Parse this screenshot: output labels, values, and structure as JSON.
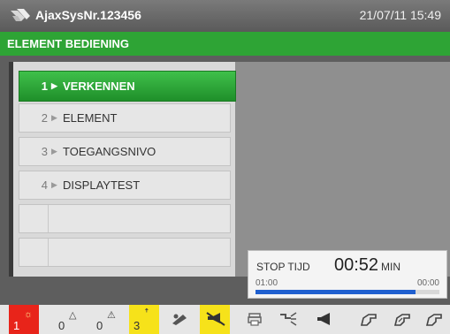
{
  "header": {
    "system_name": "AjaxSysNr.123456",
    "datetime": "21/07/11 15:49",
    "logo_icon": "ajax-logo-icon"
  },
  "title": "ELEMENT BEDIENING",
  "menu": {
    "items": [
      {
        "num": "1",
        "label": "VERKENNEN",
        "active": true
      },
      {
        "num": "2",
        "label": "ELEMENT"
      },
      {
        "num": "3",
        "label": "TOEGANGSNIVO"
      },
      {
        "num": "4",
        "label": "DISPLAYTEST"
      }
    ],
    "arrow": "▶"
  },
  "timer": {
    "label": "STOP TIJD",
    "time": "00:52",
    "unit": "MIN",
    "start": "01:00",
    "end": "00:00",
    "progress_fraction": 0.87
  },
  "status": {
    "items": [
      {
        "count": "1",
        "symbol": "☼",
        "color": "#e8241a",
        "icon": "fire-alarm-icon"
      },
      {
        "count": "0",
        "symbol": "△",
        "icon": "fault-icon"
      },
      {
        "count": "0",
        "symbol": "⚠",
        "icon": "warning-icon"
      },
      {
        "count": "3",
        "symbol": "ꜛ",
        "color": "#f6e21a",
        "icon": "disabled-icon"
      },
      {
        "icon": "door-icon"
      },
      {
        "icon": "horn-muted-icon",
        "color": "#f6e21a"
      },
      {
        "icon": "printer-icon"
      },
      {
        "icon": "water-icon"
      },
      {
        "icon": "speaker-icon"
      },
      {
        "icon": "hand-icon-1"
      },
      {
        "icon": "hand-icon-2"
      },
      {
        "icon": "hand-icon-3"
      }
    ]
  },
  "colors": {
    "accent_green": "#2ea435",
    "alarm_red": "#e8241a",
    "warning_yellow": "#f6e21a",
    "progress_blue": "#1f5fcf"
  }
}
